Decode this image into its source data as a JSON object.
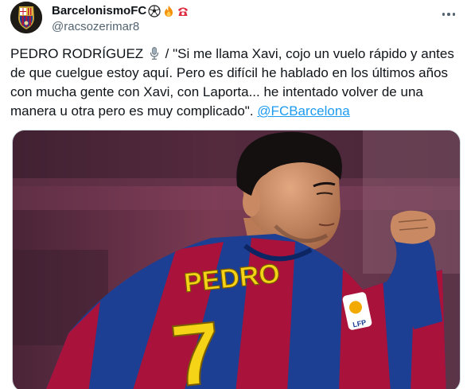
{
  "author": {
    "display_name": "BarcelonismoFC",
    "handle": "@racsozerimar8",
    "badges": [
      "soccer-ball-icon",
      "fire-icon",
      "telephone-icon"
    ]
  },
  "tweet": {
    "part1": "PEDRO RODRÍGUEZ ",
    "part2": " / \"Si me llama Xavi, cojo un vuelo rápido y antes de que cuelgue estoy aquí. Pero es difícil he hablado en los últimos años con mucha gente con Xavi, con Laporta... he intentado volver de una manera u otra pero es muy complicado\". ",
    "mention": "@FCBarcelona"
  },
  "media": {
    "jersey_name": "PEDRO",
    "jersey_number": "7",
    "colors": {
      "blaugrana_blue": "#1c3f93",
      "blaugrana_red": "#a8123b",
      "gold": "#f5d417"
    }
  }
}
